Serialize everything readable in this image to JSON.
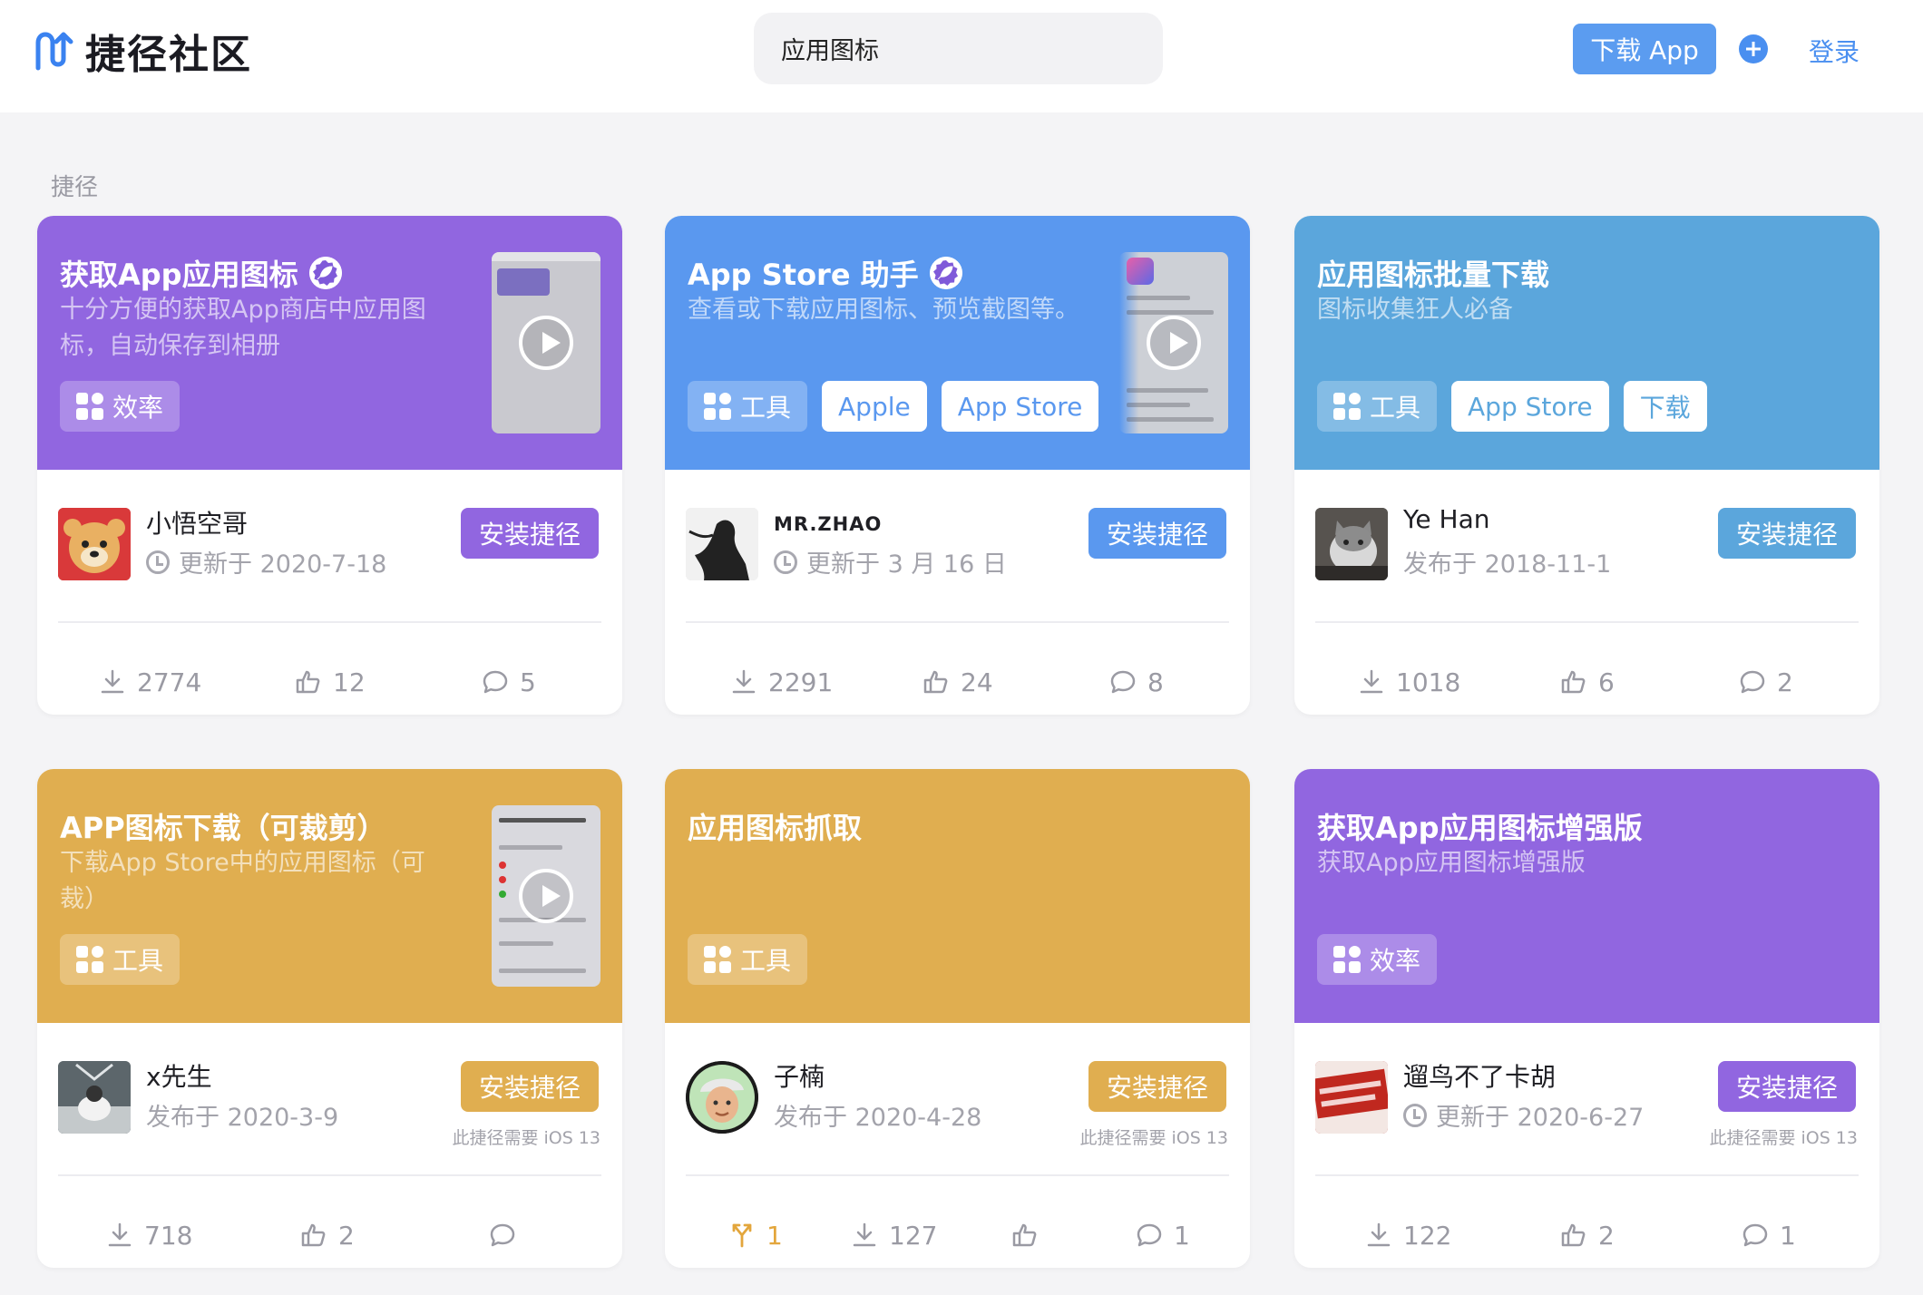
{
  "header": {
    "logo_text": "捷径社区",
    "search_value": "应用图标",
    "download_app_label": "下载 App",
    "login_label": "登录"
  },
  "section_label": "捷径",
  "colors": {
    "purple": "#9166e0",
    "blue": "#5a98ef",
    "skyblue": "#5ba6dc",
    "gold": "#e0ae50",
    "accent_link": "#4a8ff0"
  },
  "cards": [
    {
      "title": "获取App应用图标",
      "desc": "十分方便的获取App商店中应用图标，自动保存到相册",
      "tags": [
        "效率"
      ],
      "author": "小悟空哥",
      "meta": "更新于 2020-7-18",
      "install_label": "安装捷径",
      "downloads": "2774",
      "likes": "12",
      "comments": "5"
    },
    {
      "title": "App Store 助手",
      "desc": "查看或下载应用图标、预览截图等。",
      "tags": [
        "工具",
        "Apple",
        "App Store"
      ],
      "author": "MR.ZHAO",
      "meta": "更新于 3 月 16 日",
      "install_label": "安装捷径",
      "downloads": "2291",
      "likes": "24",
      "comments": "8"
    },
    {
      "title": "应用图标批量下载",
      "desc": "图标收集狂人必备",
      "tags": [
        "工具",
        "App Store",
        "下载"
      ],
      "author": "Ye Han",
      "meta": "发布于 2018-11-1",
      "install_label": "安装捷径",
      "downloads": "1018",
      "likes": "6",
      "comments": "2"
    },
    {
      "title": "APP图标下载（可裁剪）",
      "desc": "下载App Store中的应用图标（可裁）",
      "tags": [
        "工具"
      ],
      "author": "x先生",
      "meta": "发布于 2020-3-9",
      "install_label": "安装捷径",
      "ios_note": "此捷径需要 iOS 13",
      "downloads": "718",
      "likes": "2",
      "comments": ""
    },
    {
      "title": "应用图标抓取",
      "desc": "",
      "tags": [
        "工具"
      ],
      "author": "子楠",
      "meta": "发布于 2020-4-28",
      "install_label": "安装捷径",
      "ios_note": "此捷径需要 iOS 13",
      "forks": "1",
      "downloads": "127",
      "likes": "",
      "comments": "1"
    },
    {
      "title": "获取App应用图标增强版",
      "desc": "获取App应用图标增强版",
      "tags": [
        "效率"
      ],
      "author": "遛鸟不了卡胡",
      "meta": "更新于 2020-6-27",
      "install_label": "安装捷径",
      "ios_note": "此捷径需要 iOS 13",
      "downloads": "122",
      "likes": "2",
      "comments": "1"
    }
  ],
  "icons": {
    "download": "download-icon",
    "like": "thumbs-up-icon",
    "comment": "comment-icon",
    "fork": "fork-icon",
    "clock": "clock-icon",
    "play": "play-icon",
    "verified": "verified-badge-icon",
    "category": "category-grid-icon"
  }
}
